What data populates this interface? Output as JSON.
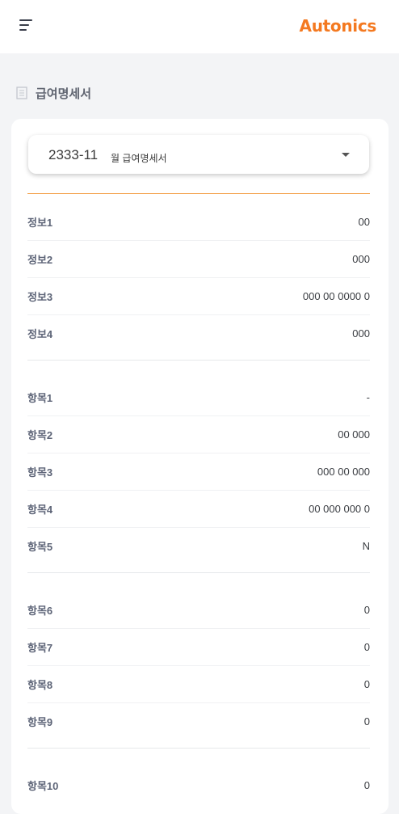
{
  "brand": {
    "logo_text": "Autonics",
    "accent_color": "#f47920"
  },
  "page": {
    "title": "급여명세서"
  },
  "selector": {
    "value": "2333-11",
    "suffix": "월 급여명세서"
  },
  "groups": [
    [
      {
        "label": "정보1",
        "value": "00"
      },
      {
        "label": "정보2",
        "value": "000"
      },
      {
        "label": "정보3",
        "value": "000 00 0000 0"
      },
      {
        "label": "정보4",
        "value": "000"
      }
    ],
    [
      {
        "label": "항목1",
        "value": "-"
      },
      {
        "label": "항목2",
        "value": "00 000"
      },
      {
        "label": "항목3",
        "value": "000 00 000"
      },
      {
        "label": "항목4",
        "value": "00 000 000 0"
      },
      {
        "label": "항목5",
        "value": "N"
      }
    ],
    [
      {
        "label": "항목6",
        "value": "0"
      },
      {
        "label": "항목7",
        "value": "0"
      },
      {
        "label": "항목8",
        "value": "0"
      },
      {
        "label": "항목9",
        "value": "0"
      }
    ],
    [
      {
        "label": "항목10",
        "value": "0"
      }
    ]
  ]
}
